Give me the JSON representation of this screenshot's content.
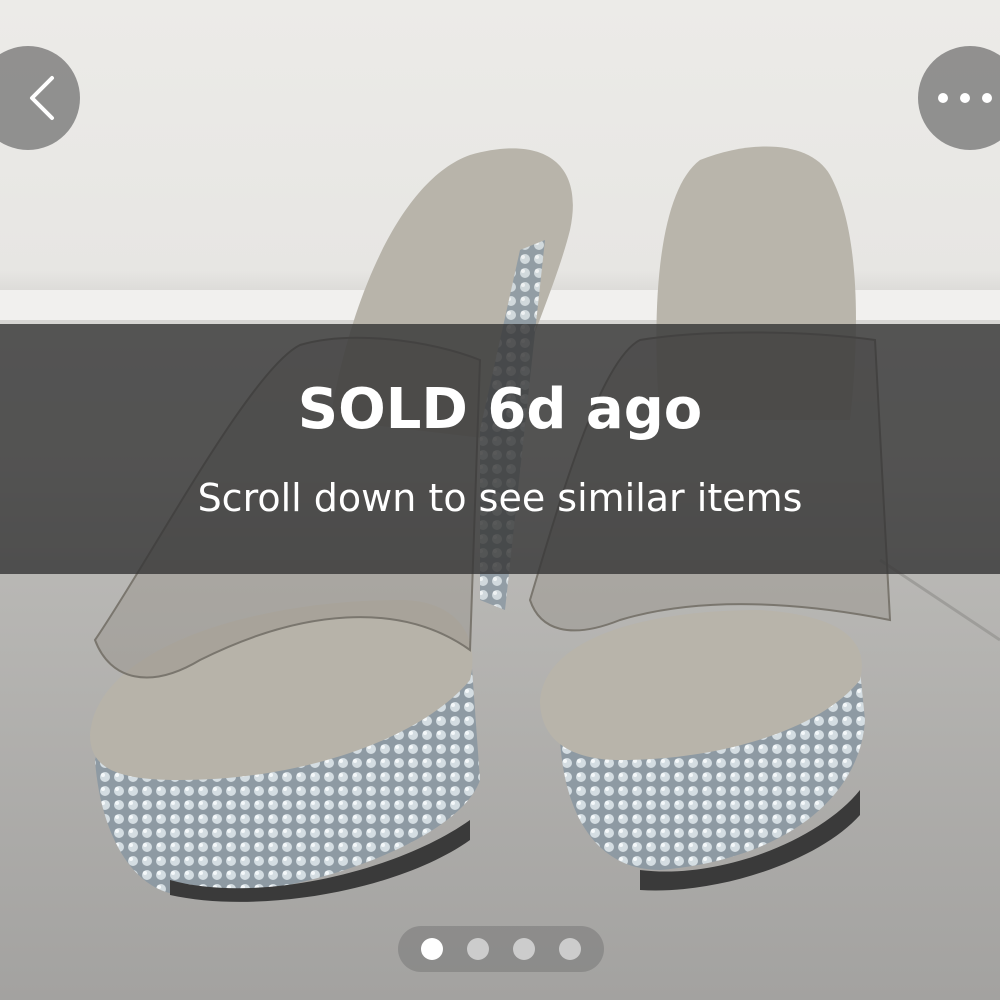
{
  "status": {
    "sold_label": "SOLD 6d ago",
    "subtitle": "Scroll down to see similar items"
  },
  "toolbar": {
    "back_icon": "chevron-left-icon",
    "more_icon": "more-horizontal-icon"
  },
  "gallery": {
    "total_images": 4,
    "active_index": 0
  },
  "colors": {
    "overlay": "#373737",
    "text": "#ffffff"
  }
}
